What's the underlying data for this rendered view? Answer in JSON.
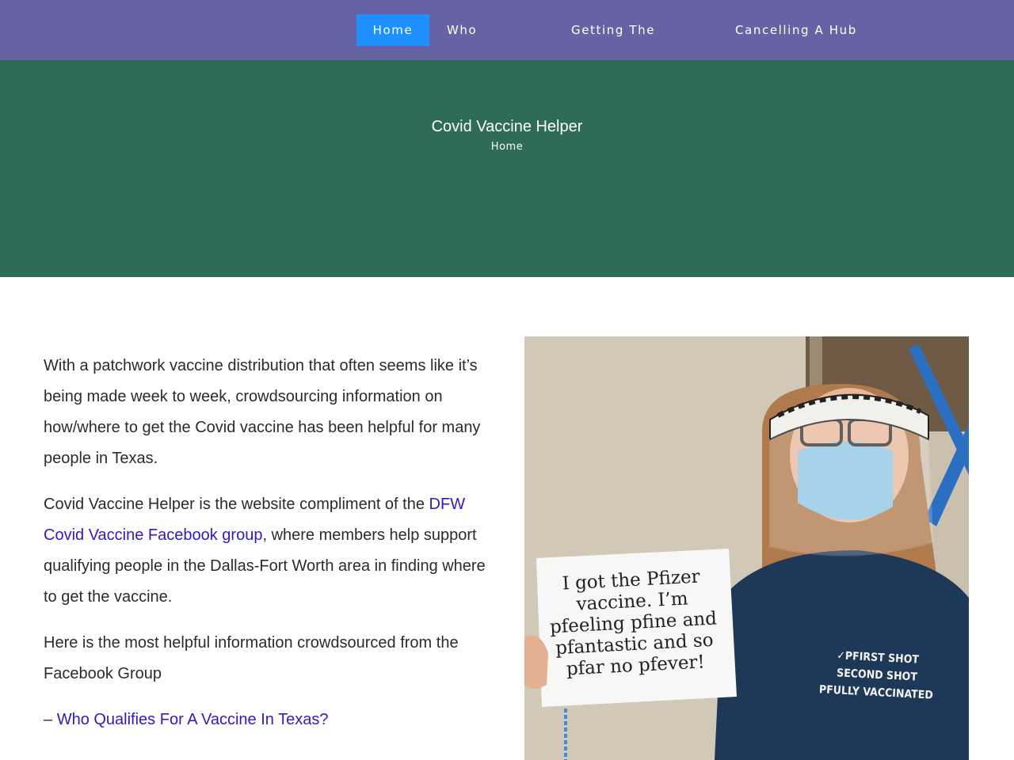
{
  "nav": {
    "items": [
      {
        "label": "Home",
        "active": true
      },
      {
        "label": "Who"
      },
      {
        "label": "Getting The"
      },
      {
        "label": "Cancelling A Hub"
      }
    ]
  },
  "hero": {
    "title": "Covid Vaccine Helper",
    "breadcrumb": "Home"
  },
  "content": {
    "p1": "With a patchwork vaccine distribution that often seems like it’s being made week to week, crowdsourcing information on how/where to get the Covid vaccine has been helpful for many people in Texas.",
    "p2_before": "Covid Vaccine Helper is the website compliment of the ",
    "p2_link": "DFW Covid Vaccine Facebook group",
    "p2_after": ", where members help support qualifying people in the Dallas-Fort Worth area in finding where to get the vaccine.",
    "p3": "Here is the most helpful information crowdsourced from the Facebook Group",
    "list_dash": "– ",
    "list_link": "Who Qualifies For A Vaccine In Texas?"
  },
  "photo": {
    "sign_lines": [
      "I got the Pfizer",
      "vaccine.  I’m",
      "pfeeling pfine and",
      "pfantastic and so",
      "pfar no pfever!"
    ],
    "shirt_lines": [
      "✓PFIRST SHOT",
      "SECOND SHOT",
      "PFULLY VACCINATED"
    ]
  },
  "colors": {
    "nav_bg": "#6563a4",
    "nav_active": "#1e90ff",
    "hero_bg": "#2e6b58",
    "link": "#2d1bc9"
  }
}
